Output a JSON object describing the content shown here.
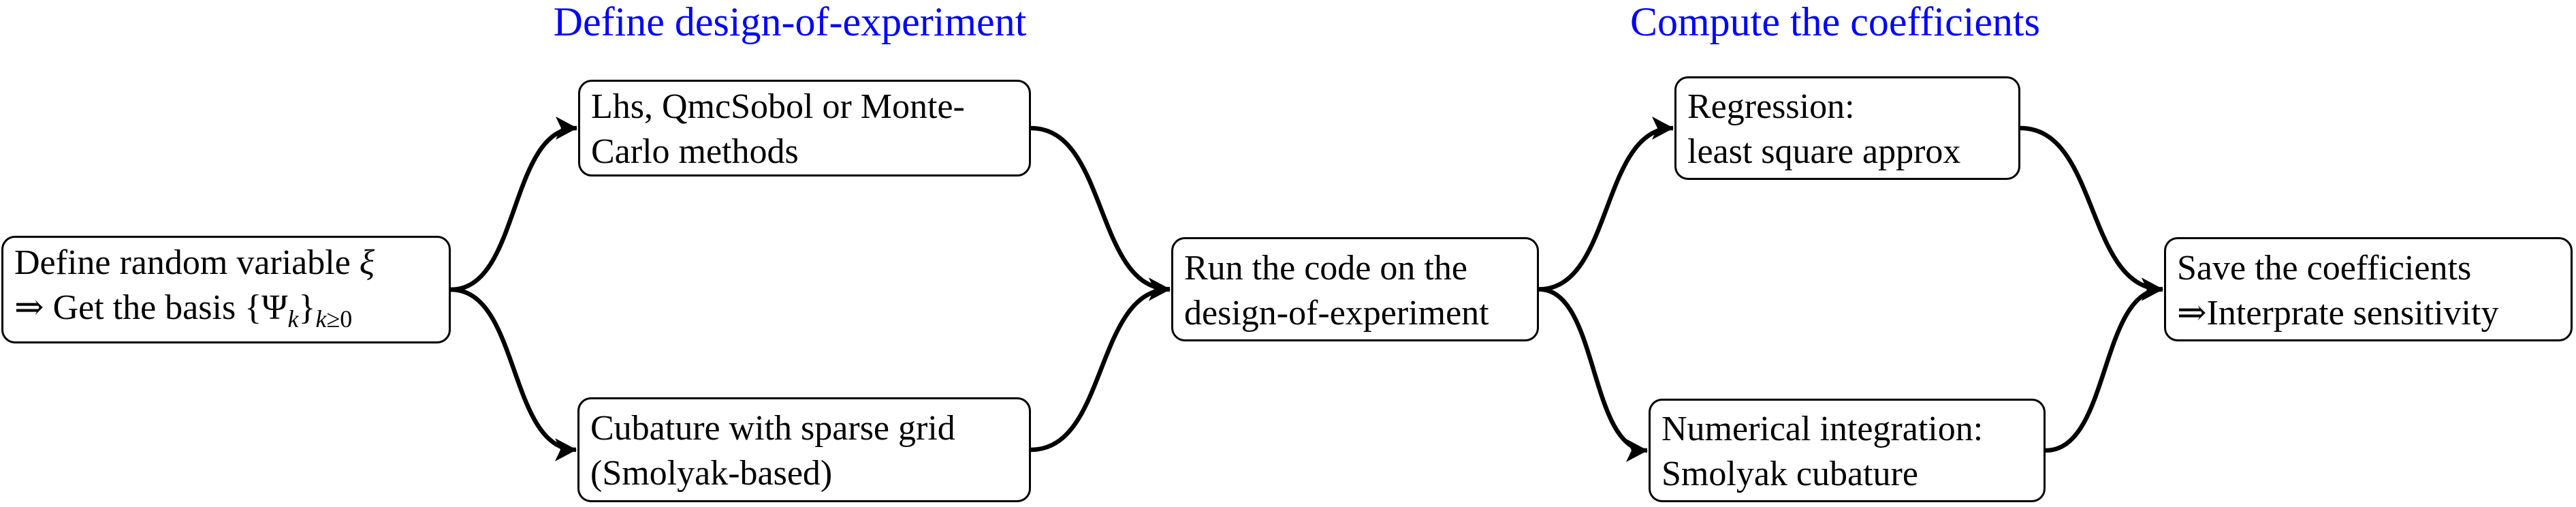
{
  "colors": {
    "section_title": "#0000FF",
    "node_border": "#000000",
    "edge": "#000000",
    "background": "#FFFFFF"
  },
  "section_titles": [
    {
      "id": "doe",
      "text": "Define design-of-experiment"
    },
    {
      "id": "coeffs",
      "text": "Compute the coefficients"
    }
  ],
  "nodes": {
    "random_variable": {
      "line1_text": "Define random variable ",
      "line1_symbol": "ξ",
      "line2_arrow": "⇒",
      "line2_text": " Get the basis ",
      "line2_set_open": "{Ψ",
      "line2_set_index": "k",
      "line2_set_close": "}",
      "line2_sub_var": "k",
      "line2_sub_rel": "≥0"
    },
    "lhs": {
      "lines": [
        "Lhs, QmcSobol or Monte-",
        "Carlo methods"
      ]
    },
    "cubature_grid": {
      "lines": [
        "Cubature with sparse grid",
        "(Smolyak-based)"
      ]
    },
    "run_code": {
      "lines": [
        "Run the code on the",
        "design-of-experiment"
      ]
    },
    "regression": {
      "lines": [
        "Regression:",
        "least square approx"
      ]
    },
    "numerical_integration": {
      "lines": [
        "Numerical integration:",
        "Smolyak cubature"
      ]
    },
    "save_coefficients": {
      "lines": [
        "Save the coefficients",
        "⇒Interprate sensitivity"
      ]
    }
  },
  "edges": [
    {
      "from": "random_variable",
      "to": "lhs"
    },
    {
      "from": "random_variable",
      "to": "cubature_grid"
    },
    {
      "from": "lhs",
      "to": "run_code"
    },
    {
      "from": "cubature_grid",
      "to": "run_code"
    },
    {
      "from": "run_code",
      "to": "regression"
    },
    {
      "from": "run_code",
      "to": "numerical_integration"
    },
    {
      "from": "regression",
      "to": "save_coefficients"
    },
    {
      "from": "numerical_integration",
      "to": "save_coefficients"
    }
  ]
}
